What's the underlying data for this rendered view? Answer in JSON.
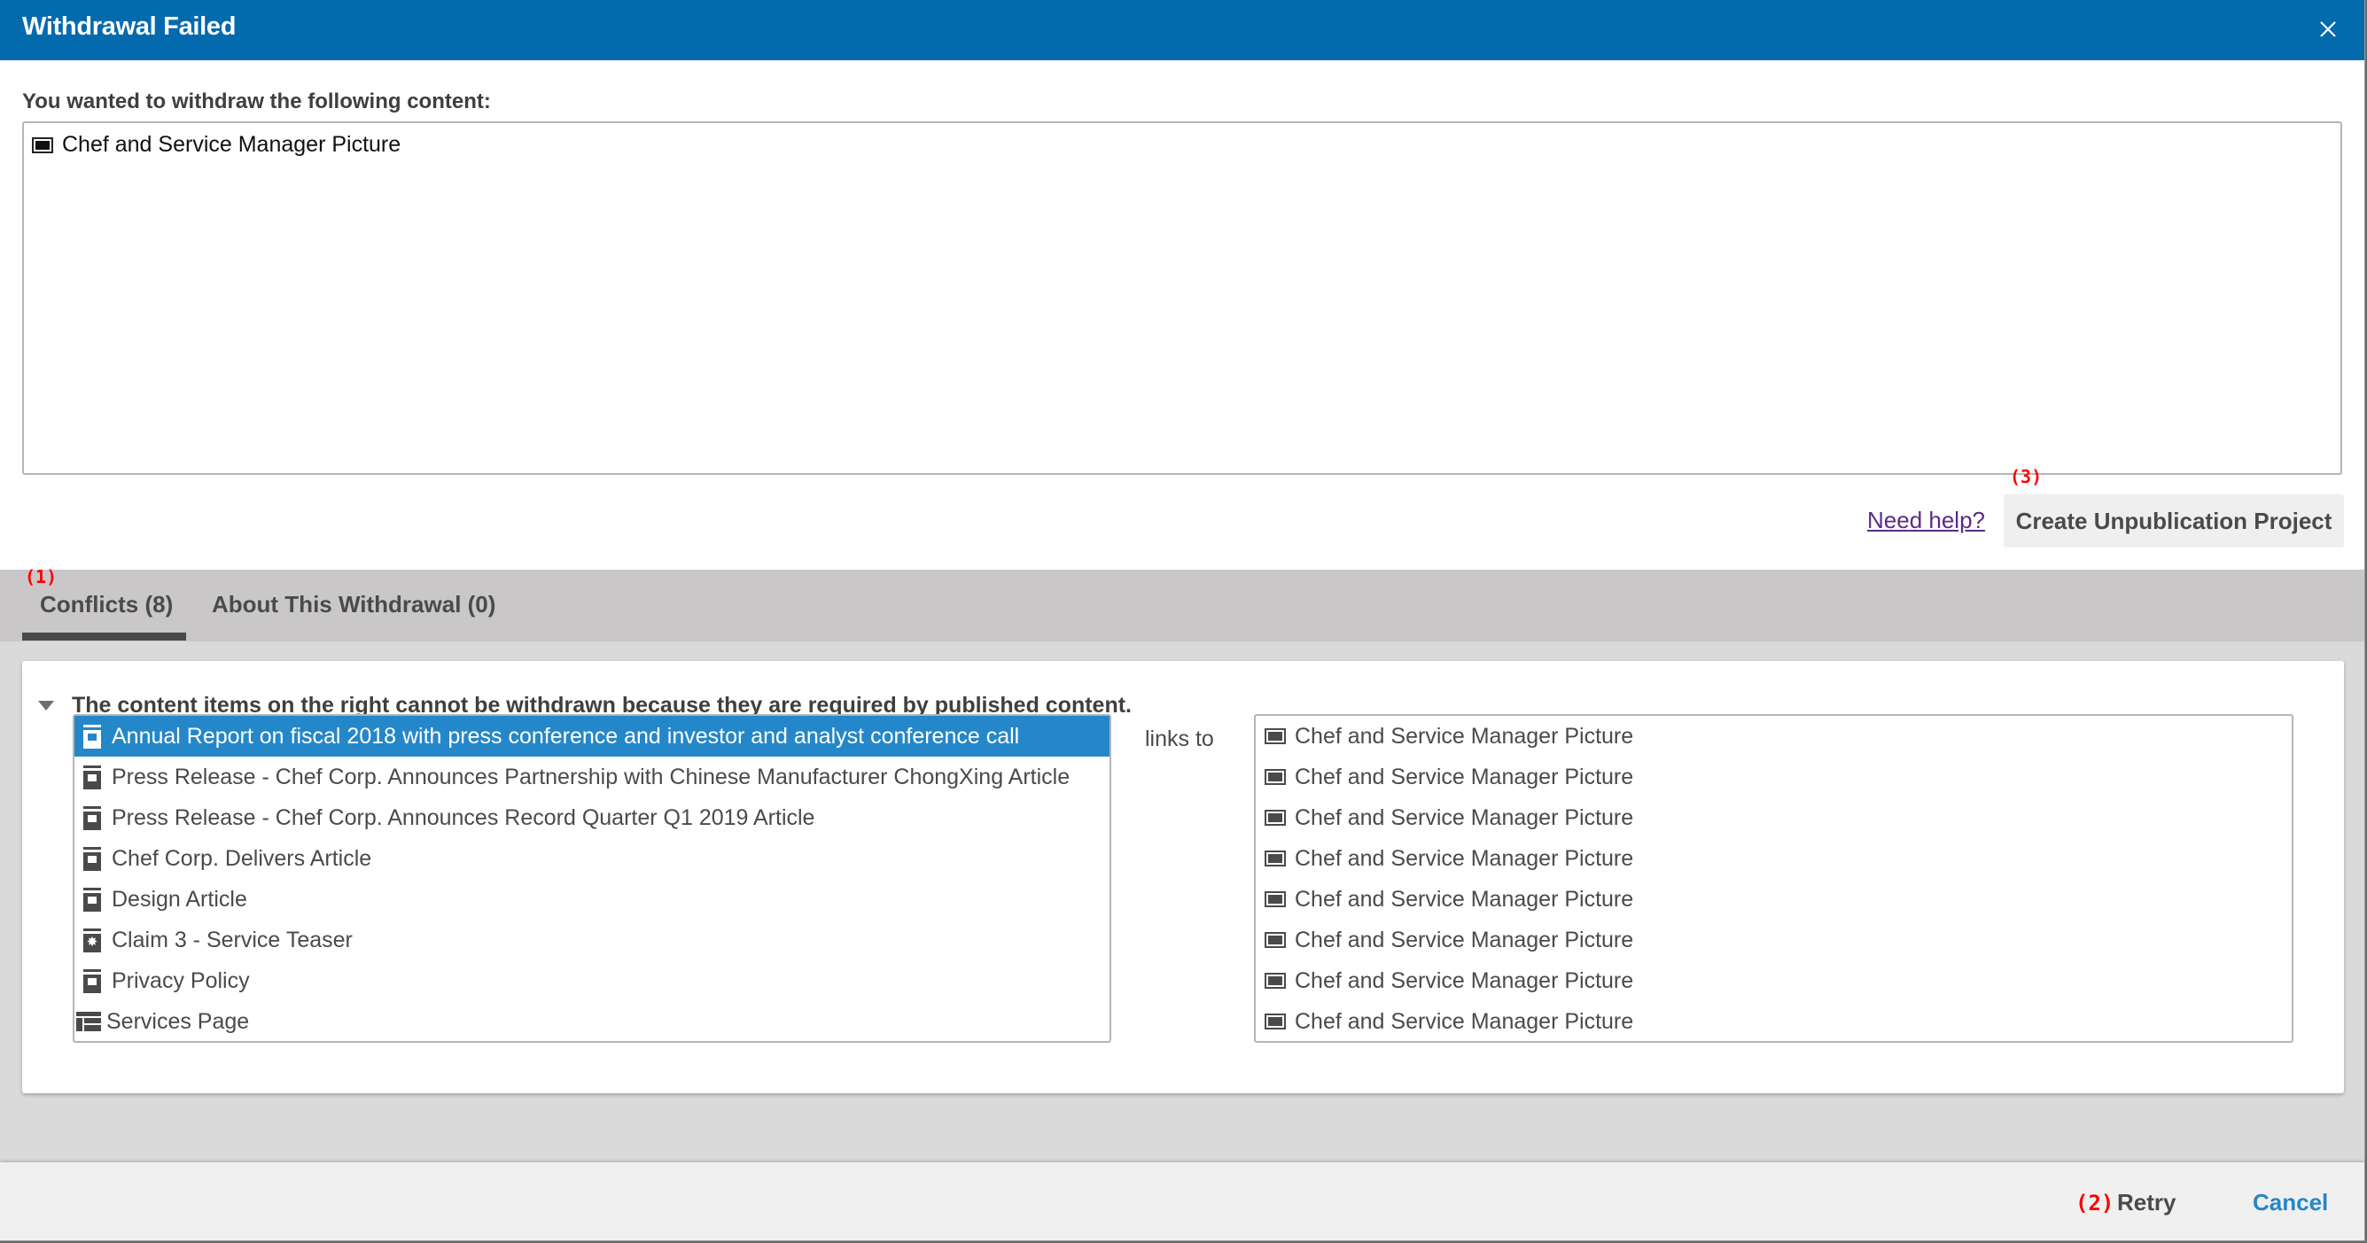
{
  "dialog": {
    "title": "Withdrawal Failed",
    "close_icon": "close-icon"
  },
  "withdraw": {
    "label": "You wanted to withdraw the following content:",
    "items": [
      {
        "icon": "picture-icon",
        "label": "Chef and Service Manager Picture"
      }
    ]
  },
  "actions": {
    "help_link": "Need help?",
    "create_project": "Create Unpublication Project"
  },
  "annotations": {
    "tabs": "(1)",
    "retry": "(2)",
    "create_project": "(3)"
  },
  "tabs": [
    {
      "label": "Conflicts (8)",
      "active": true
    },
    {
      "label": "About This Withdrawal (0)",
      "active": false
    }
  ],
  "conflicts": {
    "heading": "The content items on the right cannot be withdrawn because they are required by published content.",
    "links_to_label": "links to",
    "left_items": [
      {
        "icon": "article-icon",
        "label": "Annual Report on fiscal 2018 with press conference and investor and analyst conference call",
        "selected": true
      },
      {
        "icon": "article-icon",
        "label": "Press Release - Chef Corp. Announces Partnership with Chinese Manufacturer ChongXing Article"
      },
      {
        "icon": "article-icon",
        "label": "Press Release - Chef Corp. Announces Record Quarter Q1 2019 Article"
      },
      {
        "icon": "article-icon",
        "label": "Chef Corp. Delivers Article"
      },
      {
        "icon": "article-icon",
        "label": "Design Article"
      },
      {
        "icon": "teaser-icon",
        "label": "Claim 3 - Service Teaser"
      },
      {
        "icon": "article-icon",
        "label": "Privacy Policy"
      },
      {
        "icon": "page-icon",
        "label": "Services Page"
      }
    ],
    "right_items": [
      {
        "icon": "picture-icon",
        "label": "Chef and Service Manager Picture"
      },
      {
        "icon": "picture-icon",
        "label": "Chef and Service Manager Picture"
      },
      {
        "icon": "picture-icon",
        "label": "Chef and Service Manager Picture"
      },
      {
        "icon": "picture-icon",
        "label": "Chef and Service Manager Picture"
      },
      {
        "icon": "picture-icon",
        "label": "Chef and Service Manager Picture"
      },
      {
        "icon": "picture-icon",
        "label": "Chef and Service Manager Picture"
      },
      {
        "icon": "picture-icon",
        "label": "Chef and Service Manager Picture"
      },
      {
        "icon": "picture-icon",
        "label": "Chef and Service Manager Picture"
      }
    ]
  },
  "footer": {
    "retry": "Retry",
    "cancel": "Cancel"
  },
  "colors": {
    "titlebar": "#036aae",
    "selection": "#2487c9",
    "link": "#5b2a86",
    "annotation": "#ff0000"
  }
}
